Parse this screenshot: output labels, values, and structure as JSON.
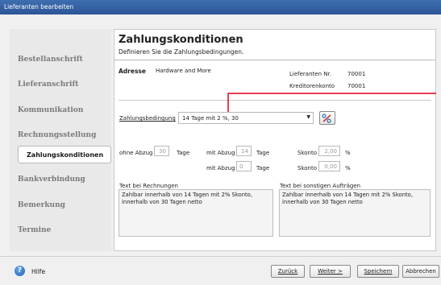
{
  "window": {
    "title": "Lieferanten bearbeiten"
  },
  "sidebar": {
    "items": [
      {
        "label": "Bestellanschrift"
      },
      {
        "label": "Lieferanschrift"
      },
      {
        "label": "Kommunikation"
      },
      {
        "label": "Rechnungsstellung"
      },
      {
        "label": "Zahlungskonditionen",
        "active": true
      },
      {
        "label": "Bankverbindung"
      },
      {
        "label": "Bemerkung"
      },
      {
        "label": "Termine"
      }
    ]
  },
  "header": {
    "title": "Zahlungskonditionen",
    "subtitle": "Definieren Sie die Zahlungsbedingungen."
  },
  "address": {
    "label": "Adresse",
    "value": "Hardware and More",
    "supplier_no_label": "Lieferanten Nr.",
    "supplier_no": "70001",
    "creditor_label": "Kreditorenkonto",
    "creditor": "70001"
  },
  "terms": {
    "label": "Zahlungsbedingung",
    "selected": "14 Tage mit 2 %, 30"
  },
  "discount": {
    "ohne_label": "ohne Abzug",
    "ohne_value": "30",
    "tage1": "Tage",
    "mit_label1": "mit Abzug",
    "mit_value1": "14",
    "tage2": "Tage",
    "skonto_label1": "Skonto",
    "skonto_value1": "2,00",
    "pct1": "%",
    "mit_label2": "mit Abzug",
    "mit_value2": "0",
    "tage3": "Tage",
    "skonto_label2": "Skonto",
    "skonto_value2": "0,00",
    "pct2": "%"
  },
  "texts": {
    "invoice_label": "Text bei Rechnungen",
    "invoice_text": "Zahlbar innerhalb von 14 Tagen mit 2% Skonto, innerhalb von 30 Tagen netto",
    "other_label": "Text bei sonstigen Aufträgen",
    "other_text": "Zahlbar innerhalb von 14 Tagen mit 2% Skonto, innerhalb von 30 Tagen netto"
  },
  "footer": {
    "help": "Hilfe",
    "back": "Zurück",
    "next": "Weiter >",
    "save": "Speichern",
    "cancel": "Abbrechen"
  },
  "colors": {
    "accent": "#e2001a",
    "titlebar": "#2d5597"
  }
}
